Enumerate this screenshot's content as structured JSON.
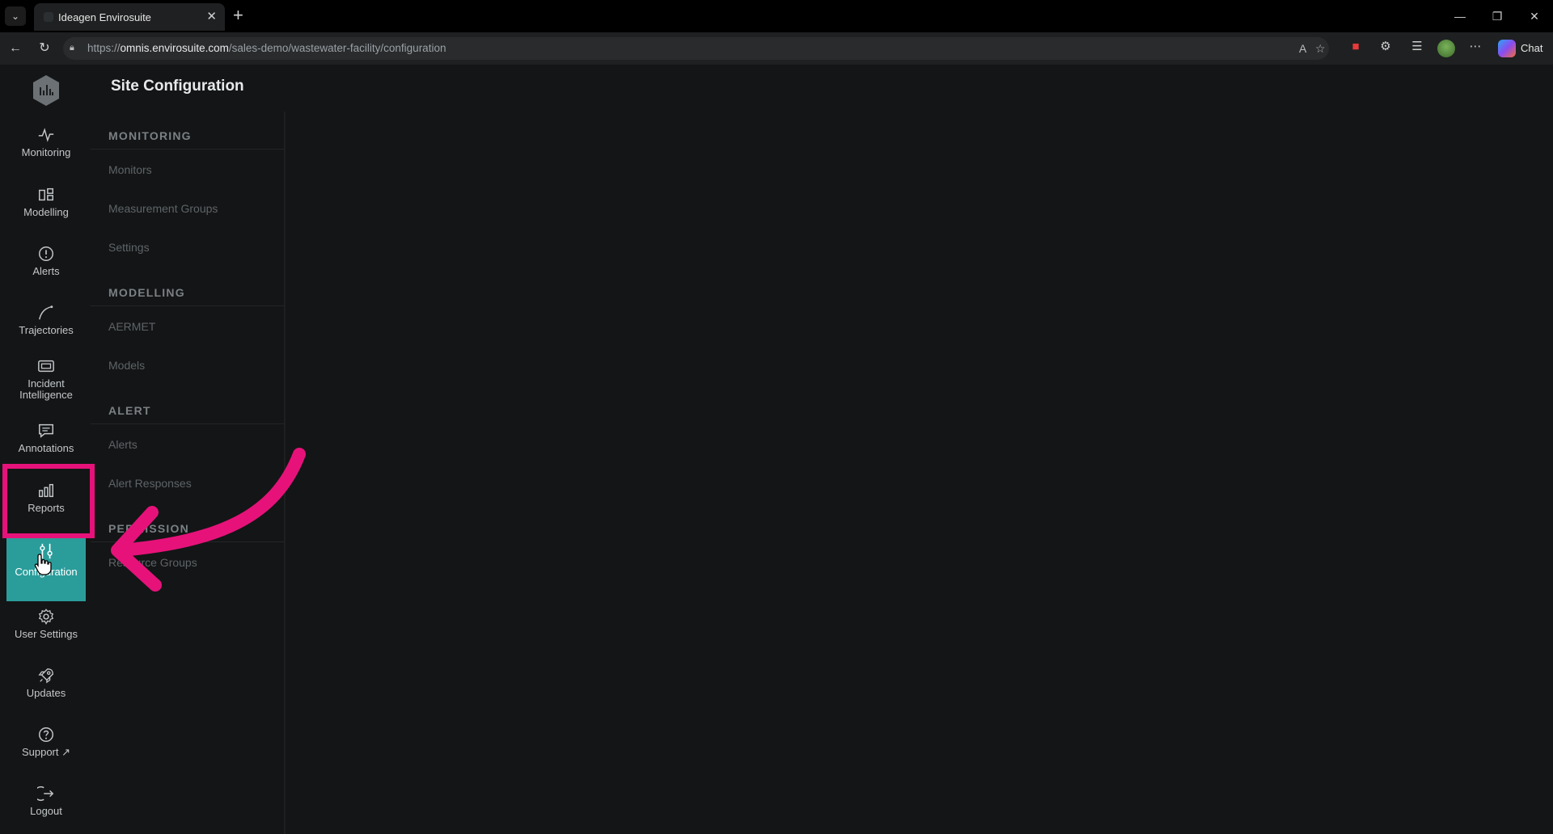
{
  "browser": {
    "tab_title": "Ideagen Envirosuite",
    "url_scheme": "https://",
    "url_host": "omnis.envirosuite.com",
    "url_path": "/sales-demo/wastewater-facility/configuration",
    "chat_label": "Chat"
  },
  "app": {
    "page_title": "Site Configuration",
    "nav": [
      {
        "label": "Monitoring",
        "icon": "activity-icon"
      },
      {
        "label": "Modelling",
        "icon": "modelling-icon"
      },
      {
        "label": "Alerts",
        "icon": "alert-circle-icon"
      },
      {
        "label": "Trajectories",
        "icon": "trajectory-icon"
      },
      {
        "label": "Incident Intelligence",
        "icon": "incident-icon"
      },
      {
        "label": "Annotations",
        "icon": "annotation-icon"
      },
      {
        "label": "Reports",
        "icon": "bar-chart-icon"
      },
      {
        "label": "Configuration",
        "icon": "sliders-icon",
        "active": true
      },
      {
        "label": "User Settings",
        "icon": "gear-icon"
      },
      {
        "label": "Updates",
        "icon": "rocket-icon"
      },
      {
        "label": "Support",
        "icon": "help-circle-icon"
      },
      {
        "label": "Logout",
        "icon": "logout-icon"
      }
    ],
    "subnav": {
      "monitoring_heading": "MONITORING",
      "monitoring_items": [
        "Monitors",
        "Measurement Groups",
        "Settings"
      ],
      "modelling_heading": "MODELLING",
      "modelling_items": [
        "AERMET",
        "Models"
      ],
      "alert_heading": "ALERT",
      "alert_items": [
        "Alerts",
        "Alert Responses"
      ],
      "permission_heading": "PERMISSION",
      "permission_items": [
        "Resource Groups"
      ]
    }
  },
  "colors": {
    "accent": "#2a9d9b",
    "annotation": "#e6127a",
    "background": "#141516"
  }
}
